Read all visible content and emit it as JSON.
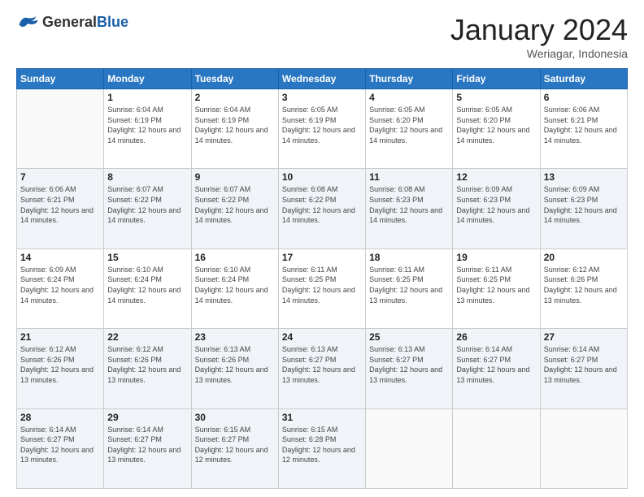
{
  "header": {
    "logo": {
      "text_general": "General",
      "text_blue": "Blue"
    },
    "title": "January 2024",
    "location": "Weriagar, Indonesia"
  },
  "weekdays": [
    "Sunday",
    "Monday",
    "Tuesday",
    "Wednesday",
    "Thursday",
    "Friday",
    "Saturday"
  ],
  "weeks": [
    [
      {
        "day": "",
        "sunrise": "",
        "sunset": "",
        "daylight": ""
      },
      {
        "day": "1",
        "sunrise": "6:04 AM",
        "sunset": "6:19 PM",
        "daylight": "12 hours and 14 minutes."
      },
      {
        "day": "2",
        "sunrise": "6:04 AM",
        "sunset": "6:19 PM",
        "daylight": "12 hours and 14 minutes."
      },
      {
        "day": "3",
        "sunrise": "6:05 AM",
        "sunset": "6:19 PM",
        "daylight": "12 hours and 14 minutes."
      },
      {
        "day": "4",
        "sunrise": "6:05 AM",
        "sunset": "6:20 PM",
        "daylight": "12 hours and 14 minutes."
      },
      {
        "day": "5",
        "sunrise": "6:05 AM",
        "sunset": "6:20 PM",
        "daylight": "12 hours and 14 minutes."
      },
      {
        "day": "6",
        "sunrise": "6:06 AM",
        "sunset": "6:21 PM",
        "daylight": "12 hours and 14 minutes."
      }
    ],
    [
      {
        "day": "7",
        "sunrise": "6:06 AM",
        "sunset": "6:21 PM",
        "daylight": "12 hours and 14 minutes."
      },
      {
        "day": "8",
        "sunrise": "6:07 AM",
        "sunset": "6:22 PM",
        "daylight": "12 hours and 14 minutes."
      },
      {
        "day": "9",
        "sunrise": "6:07 AM",
        "sunset": "6:22 PM",
        "daylight": "12 hours and 14 minutes."
      },
      {
        "day": "10",
        "sunrise": "6:08 AM",
        "sunset": "6:22 PM",
        "daylight": "12 hours and 14 minutes."
      },
      {
        "day": "11",
        "sunrise": "6:08 AM",
        "sunset": "6:23 PM",
        "daylight": "12 hours and 14 minutes."
      },
      {
        "day": "12",
        "sunrise": "6:09 AM",
        "sunset": "6:23 PM",
        "daylight": "12 hours and 14 minutes."
      },
      {
        "day": "13",
        "sunrise": "6:09 AM",
        "sunset": "6:23 PM",
        "daylight": "12 hours and 14 minutes."
      }
    ],
    [
      {
        "day": "14",
        "sunrise": "6:09 AM",
        "sunset": "6:24 PM",
        "daylight": "12 hours and 14 minutes."
      },
      {
        "day": "15",
        "sunrise": "6:10 AM",
        "sunset": "6:24 PM",
        "daylight": "12 hours and 14 minutes."
      },
      {
        "day": "16",
        "sunrise": "6:10 AM",
        "sunset": "6:24 PM",
        "daylight": "12 hours and 14 minutes."
      },
      {
        "day": "17",
        "sunrise": "6:11 AM",
        "sunset": "6:25 PM",
        "daylight": "12 hours and 14 minutes."
      },
      {
        "day": "18",
        "sunrise": "6:11 AM",
        "sunset": "6:25 PM",
        "daylight": "12 hours and 13 minutes."
      },
      {
        "day": "19",
        "sunrise": "6:11 AM",
        "sunset": "6:25 PM",
        "daylight": "12 hours and 13 minutes."
      },
      {
        "day": "20",
        "sunrise": "6:12 AM",
        "sunset": "6:26 PM",
        "daylight": "12 hours and 13 minutes."
      }
    ],
    [
      {
        "day": "21",
        "sunrise": "6:12 AM",
        "sunset": "6:26 PM",
        "daylight": "12 hours and 13 minutes."
      },
      {
        "day": "22",
        "sunrise": "6:12 AM",
        "sunset": "6:26 PM",
        "daylight": "12 hours and 13 minutes."
      },
      {
        "day": "23",
        "sunrise": "6:13 AM",
        "sunset": "6:26 PM",
        "daylight": "12 hours and 13 minutes."
      },
      {
        "day": "24",
        "sunrise": "6:13 AM",
        "sunset": "6:27 PM",
        "daylight": "12 hours and 13 minutes."
      },
      {
        "day": "25",
        "sunrise": "6:13 AM",
        "sunset": "6:27 PM",
        "daylight": "12 hours and 13 minutes."
      },
      {
        "day": "26",
        "sunrise": "6:14 AM",
        "sunset": "6:27 PM",
        "daylight": "12 hours and 13 minutes."
      },
      {
        "day": "27",
        "sunrise": "6:14 AM",
        "sunset": "6:27 PM",
        "daylight": "12 hours and 13 minutes."
      }
    ],
    [
      {
        "day": "28",
        "sunrise": "6:14 AM",
        "sunset": "6:27 PM",
        "daylight": "12 hours and 13 minutes."
      },
      {
        "day": "29",
        "sunrise": "6:14 AM",
        "sunset": "6:27 PM",
        "daylight": "12 hours and 13 minutes."
      },
      {
        "day": "30",
        "sunrise": "6:15 AM",
        "sunset": "6:27 PM",
        "daylight": "12 hours and 12 minutes."
      },
      {
        "day": "31",
        "sunrise": "6:15 AM",
        "sunset": "6:28 PM",
        "daylight": "12 hours and 12 minutes."
      },
      {
        "day": "",
        "sunrise": "",
        "sunset": "",
        "daylight": ""
      },
      {
        "day": "",
        "sunrise": "",
        "sunset": "",
        "daylight": ""
      },
      {
        "day": "",
        "sunrise": "",
        "sunset": "",
        "daylight": ""
      }
    ]
  ]
}
